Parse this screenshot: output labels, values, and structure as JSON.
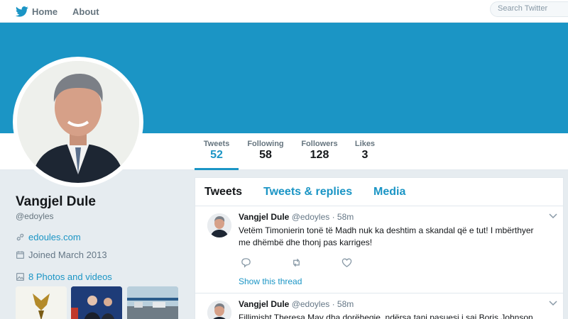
{
  "nav": {
    "home_label": "Home",
    "about_label": "About",
    "search_placeholder": "Search Twitter"
  },
  "colors": {
    "accent": "#1b95c5",
    "banner": "#1b95c5",
    "background": "#e6ecf0"
  },
  "stats": [
    {
      "label": "Tweets",
      "value": "52",
      "active": true
    },
    {
      "label": "Following",
      "value": "58"
    },
    {
      "label": "Followers",
      "value": "128"
    },
    {
      "label": "Likes",
      "value": "3"
    }
  ],
  "profile": {
    "name": "Vangjel Dule",
    "handle": "@edoyles",
    "website": "edoules.com",
    "joined": "Joined March 2013",
    "photos_label": "8 Photos and videos"
  },
  "tabs": [
    {
      "label": "Tweets",
      "active": true
    },
    {
      "label": "Tweets & replies"
    },
    {
      "label": "Media"
    }
  ],
  "tweets": [
    {
      "name": "Vangjel Dule",
      "meta": "@edoyles · 58m",
      "lines": [
        "Vetëm Timonierin tonë të Madh nuk ka deshtim a skandal që e tut!  I mbërthyer",
        "me dhëmbë dhe thonj  pas karriges!"
      ],
      "show_thread": "Show this thread"
    },
    {
      "name": "Vangjel Dule",
      "meta": "@edoyles · 58m",
      "lines": [
        "Fillimisht Theresa May dha dorëheqje, ndërsa tani pasuesi i saj Boris Johnson"
      ]
    }
  ],
  "icons": {
    "logo": "twitter-bird-icon",
    "reply": "reply-icon",
    "retweet": "retweet-icon",
    "like": "heart-icon"
  }
}
